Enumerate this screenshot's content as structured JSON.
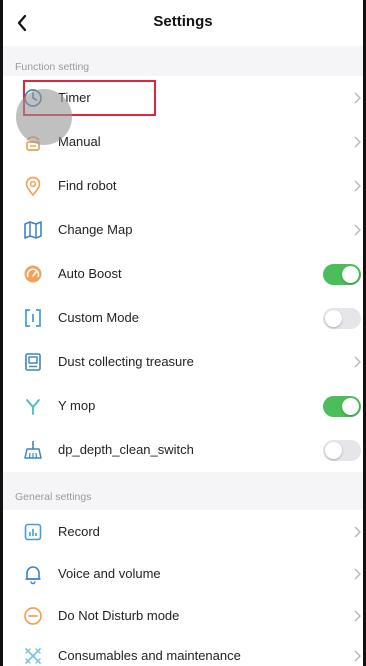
{
  "header": {
    "back_icon": "chevron-left-icon",
    "title": "Settings"
  },
  "sections": {
    "function": "Function setting",
    "general": "General settings"
  },
  "function_rows": [
    {
      "label": "Timer",
      "icon": "clock-icon",
      "control": "chevron"
    },
    {
      "label": "Manual",
      "icon": "manual-icon",
      "control": "chevron"
    },
    {
      "label": "Find robot",
      "icon": "location-pin-icon",
      "control": "chevron"
    },
    {
      "label": "Change Map",
      "icon": "map-icon",
      "control": "chevron"
    },
    {
      "label": "Auto Boost",
      "icon": "gauge-icon",
      "control": "toggle",
      "toggle_on": true
    },
    {
      "label": "Custom Mode",
      "icon": "custom-mode-icon",
      "control": "toggle",
      "toggle_on": false
    },
    {
      "label": "Dust collecting treasure",
      "icon": "dust-station-icon",
      "control": "chevron"
    },
    {
      "label": "Y mop",
      "icon": "y-mop-icon",
      "control": "toggle",
      "toggle_on": true
    },
    {
      "label": "dp_depth_clean_switch",
      "icon": "broom-icon",
      "control": "toggle",
      "toggle_on": false
    }
  ],
  "general_rows": [
    {
      "label": "Record",
      "icon": "record-icon",
      "control": "chevron"
    },
    {
      "label": "Voice and volume",
      "icon": "bell-icon",
      "control": "chevron"
    },
    {
      "label": "Do Not Disturb mode",
      "icon": "do-not-disturb-icon",
      "control": "chevron"
    },
    {
      "label": "Consumables and maintenance",
      "icon": "consumables-icon",
      "control": "chevron"
    }
  ],
  "colors": {
    "toggle_on": "#4cbd5b",
    "toggle_off": "#e5e5ea",
    "icon_accent": "#f0a35a",
    "icon_blue": "#3f83c4",
    "highlight_box": "#e0263a"
  }
}
